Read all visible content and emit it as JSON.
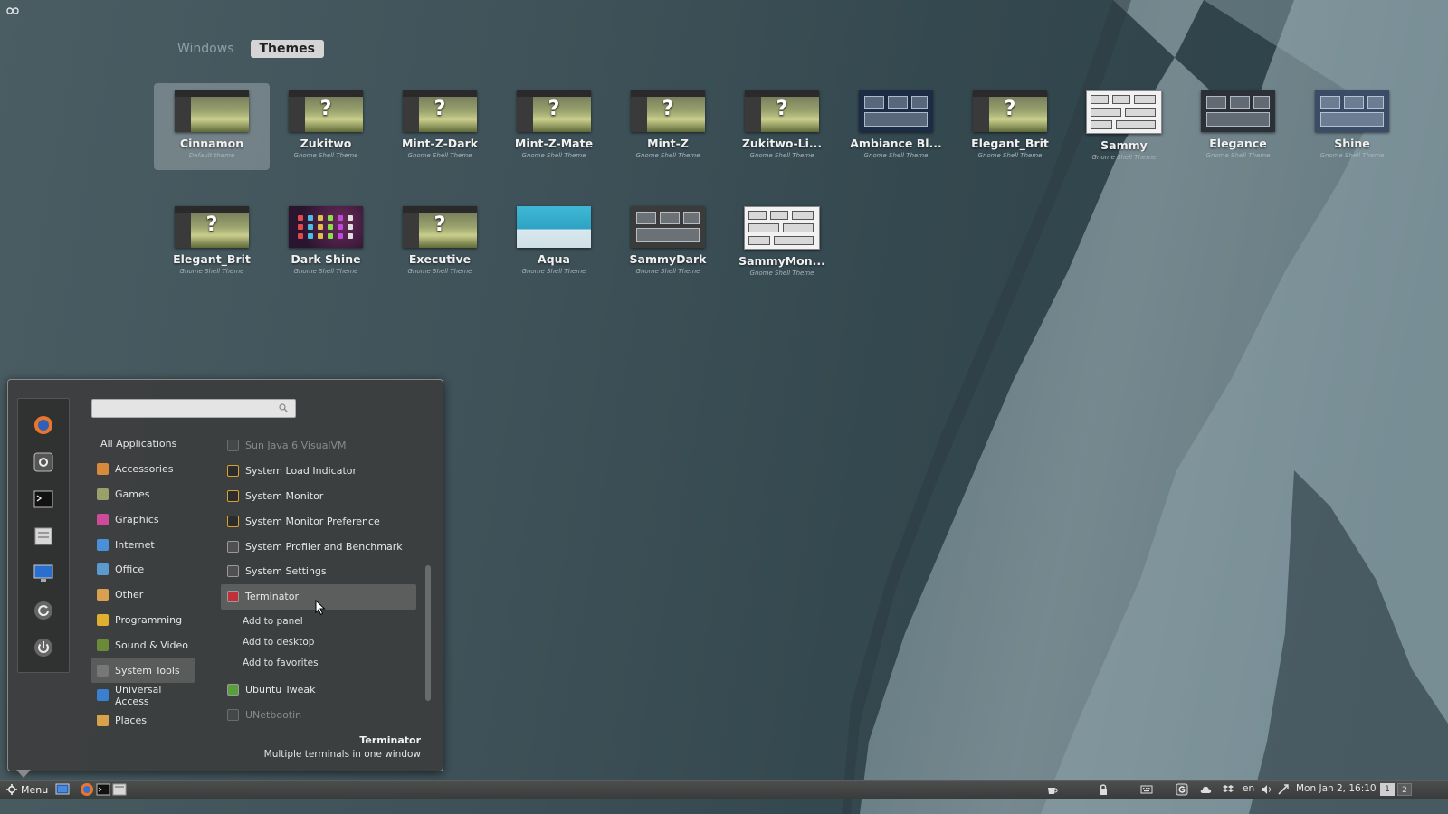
{
  "tabs": [
    {
      "label": "Windows",
      "active": false
    },
    {
      "label": "Themes",
      "active": true
    }
  ],
  "themes": [
    {
      "name": "Cinnamon",
      "subtitle": "Default theme",
      "thumb": "grass",
      "question": false,
      "selected": true
    },
    {
      "name": "Zukitwo",
      "subtitle": "Gnome Shell Theme",
      "thumb": "grass",
      "question": true
    },
    {
      "name": "Mint-Z-Dark",
      "subtitle": "Gnome Shell Theme",
      "thumb": "grass",
      "question": true
    },
    {
      "name": "Mint-Z-Mate",
      "subtitle": "Gnome Shell Theme",
      "thumb": "grass",
      "question": true
    },
    {
      "name": "Mint-Z",
      "subtitle": "Gnome Shell Theme",
      "thumb": "grass",
      "question": true
    },
    {
      "name": "Zukitwo-Li...",
      "subtitle": "Gnome Shell Theme",
      "thumb": "grass",
      "question": true
    },
    {
      "name": "Ambiance Bl...",
      "subtitle": "Gnome Shell Theme",
      "thumb": "ambiance",
      "question": false
    },
    {
      "name": "Elegant_Brit",
      "subtitle": "Gnome Shell Theme",
      "thumb": "grass",
      "question": true
    },
    {
      "name": "Sammy",
      "subtitle": "Gnome Shell Theme",
      "thumb": "sammy",
      "question": false
    },
    {
      "name": "Elegance",
      "subtitle": "Gnome Shell Theme",
      "thumb": "elegance",
      "question": false
    },
    {
      "name": "Shine",
      "subtitle": "Gnome Shell Theme",
      "thumb": "shine",
      "question": false
    },
    {
      "name": "Elegant_Brit",
      "subtitle": "Gnome Shell Theme",
      "thumb": "grass",
      "question": true
    },
    {
      "name": "Dark Shine",
      "subtitle": "Gnome Shell Theme",
      "thumb": "darkshine",
      "question": false
    },
    {
      "name": "Executive",
      "subtitle": "Gnome Shell Theme",
      "thumb": "grass",
      "question": true
    },
    {
      "name": "Aqua",
      "subtitle": "Gnome Shell Theme",
      "thumb": "aqua",
      "question": false
    },
    {
      "name": "SammyDark",
      "subtitle": "Gnome Shell Theme",
      "thumb": "sammydark",
      "question": false
    },
    {
      "name": "SammyMon...",
      "subtitle": "Gnome Shell Theme",
      "thumb": "sammy",
      "question": false
    }
  ],
  "menu": {
    "search_placeholder": "",
    "favorites": [
      {
        "icon": "firefox-icon",
        "color": "#e8762d"
      },
      {
        "icon": "system-settings-icon",
        "color": "#888888"
      },
      {
        "icon": "terminal-icon",
        "color": "#222222"
      },
      {
        "icon": "files-icon",
        "color": "#d0d0d0"
      },
      {
        "icon": "display-icon",
        "color": "#2a6fd0"
      },
      {
        "icon": "refresh-icon",
        "color": "#cccccc"
      },
      {
        "icon": "power-icon",
        "color": "#cccccc"
      }
    ],
    "categories": [
      {
        "label": "All Applications",
        "icon": "",
        "color": ""
      },
      {
        "label": "Accessories",
        "icon": "accessories-icon",
        "color": "#d88a3a"
      },
      {
        "label": "Games",
        "icon": "games-icon",
        "color": "#9aa06a"
      },
      {
        "label": "Graphics",
        "icon": "graphics-icon",
        "color": "#d04a9a"
      },
      {
        "label": "Internet",
        "icon": "internet-icon",
        "color": "#4a90d8"
      },
      {
        "label": "Office",
        "icon": "office-icon",
        "color": "#5a9ad0"
      },
      {
        "label": "Other",
        "icon": "other-icon",
        "color": "#d8a050"
      },
      {
        "label": "Programming",
        "icon": "programming-icon",
        "color": "#e0b030"
      },
      {
        "label": "Sound & Video",
        "icon": "sound-video-icon",
        "color": "#6a8a3a"
      },
      {
        "label": "System Tools",
        "icon": "system-tools-icon",
        "color": "#777777"
      },
      {
        "label": "Universal Access",
        "icon": "universal-access-icon",
        "color": "#3a80d0"
      },
      {
        "label": "Places",
        "icon": "places-icon",
        "color": "#d8a24a"
      }
    ],
    "selected_category": "System Tools",
    "apps_before": [
      {
        "label": "Sun Java 6 VisualVM",
        "faded": true
      },
      {
        "label": "System Load Indicator",
        "faded": false
      },
      {
        "label": "System Monitor",
        "faded": false
      },
      {
        "label": "System Monitor Preference",
        "faded": false
      },
      {
        "label": "System Profiler and Benchmark",
        "faded": false
      },
      {
        "label": "System Settings",
        "faded": false
      },
      {
        "label": "Terminator",
        "faded": false,
        "hovered": true
      }
    ],
    "context_items": [
      "Add to panel",
      "Add to desktop",
      "Add to favorites"
    ],
    "apps_after": [
      {
        "label": "Ubuntu Tweak",
        "faded": false
      },
      {
        "label": "UNetbootin",
        "faded": true
      }
    ],
    "description": {
      "title": "Terminator",
      "text": "Multiple terminals in one window"
    }
  },
  "taskbar": {
    "menu_label": "Menu",
    "language": "en",
    "clock": "Mon Jan 2, 16:10",
    "workspaces": [
      "1",
      "2"
    ],
    "active_workspace": "1"
  }
}
